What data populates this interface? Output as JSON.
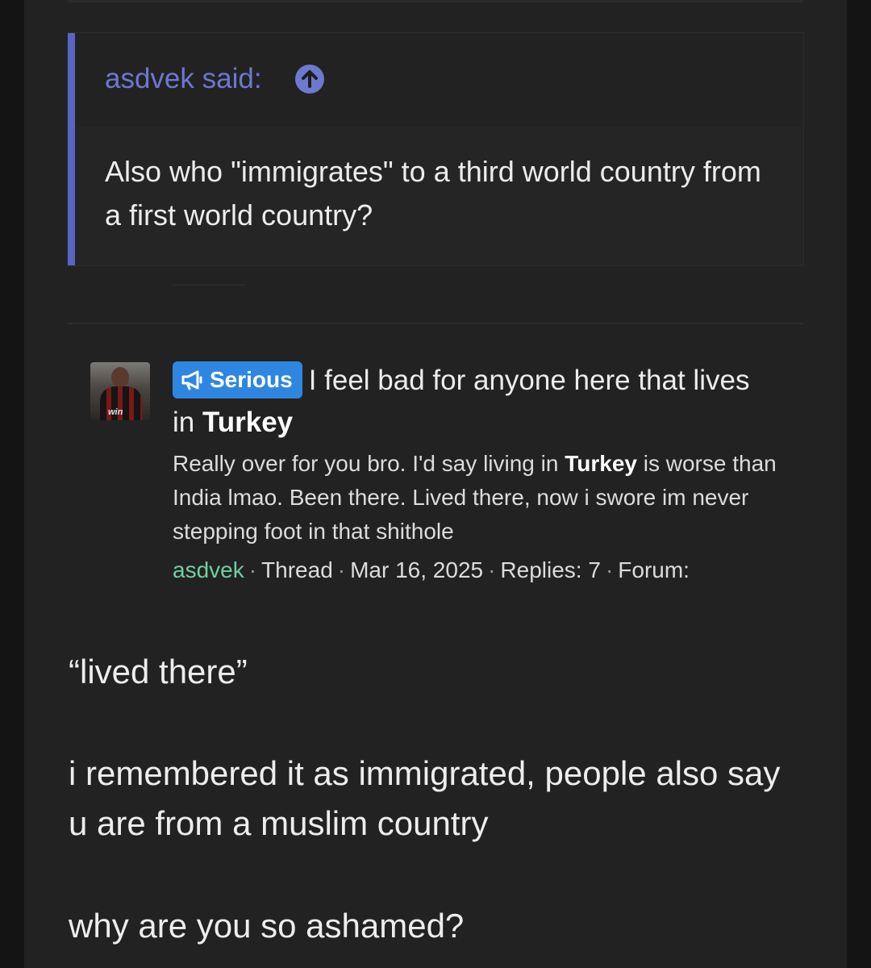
{
  "colors": {
    "page_bg": "#141414",
    "column_bg": "#222222",
    "quote_accent": "#5865c6",
    "quote_author": "#6d78cf",
    "badge_bg": "#2f86e0",
    "username_green": "#6fcfa2"
  },
  "quote": {
    "author": "asdvek said:",
    "jump_icon": "arrow-up-circle-icon",
    "text": "Also who \"immigrates\" to a third world country from a first world country?"
  },
  "thread_preview": {
    "avatar_icon": "user-avatar",
    "badge_icon": "megaphone-icon",
    "badge_label": "Serious",
    "title_prefix": "I feel bad for anyone here that lives in ",
    "title_highlight": "Turkey",
    "snippet_part1": "Really over for you bro. I'd say living in ",
    "snippet_highlight": "Turkey",
    "snippet_part2": " is worse than India lmao. Been there. Lived there, now i swore im never stepping foot in that shithole",
    "meta": {
      "author": "asdvek",
      "separator": "·",
      "type": "Thread",
      "date": "Mar 16, 2025",
      "replies": "Replies: 7",
      "forum": "Forum:"
    }
  },
  "reply": {
    "line1": "“lived there”",
    "line2": "i remembered it as immigrated, people also say u are from a muslim country",
    "line3": "why are you so ashamed?"
  }
}
